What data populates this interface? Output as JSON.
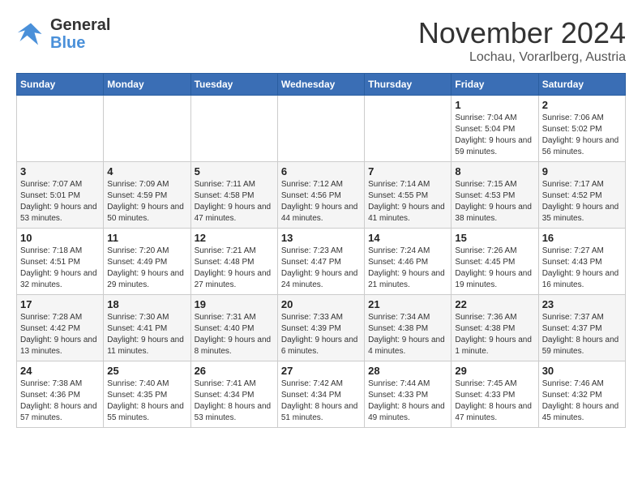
{
  "header": {
    "logo_line1": "General",
    "logo_line2": "Blue",
    "month": "November 2024",
    "location": "Lochau, Vorarlberg, Austria"
  },
  "weekdays": [
    "Sunday",
    "Monday",
    "Tuesday",
    "Wednesday",
    "Thursday",
    "Friday",
    "Saturday"
  ],
  "weeks": [
    [
      {
        "day": "",
        "info": ""
      },
      {
        "day": "",
        "info": ""
      },
      {
        "day": "",
        "info": ""
      },
      {
        "day": "",
        "info": ""
      },
      {
        "day": "",
        "info": ""
      },
      {
        "day": "1",
        "info": "Sunrise: 7:04 AM\nSunset: 5:04 PM\nDaylight: 9 hours and 59 minutes."
      },
      {
        "day": "2",
        "info": "Sunrise: 7:06 AM\nSunset: 5:02 PM\nDaylight: 9 hours and 56 minutes."
      }
    ],
    [
      {
        "day": "3",
        "info": "Sunrise: 7:07 AM\nSunset: 5:01 PM\nDaylight: 9 hours and 53 minutes."
      },
      {
        "day": "4",
        "info": "Sunrise: 7:09 AM\nSunset: 4:59 PM\nDaylight: 9 hours and 50 minutes."
      },
      {
        "day": "5",
        "info": "Sunrise: 7:11 AM\nSunset: 4:58 PM\nDaylight: 9 hours and 47 minutes."
      },
      {
        "day": "6",
        "info": "Sunrise: 7:12 AM\nSunset: 4:56 PM\nDaylight: 9 hours and 44 minutes."
      },
      {
        "day": "7",
        "info": "Sunrise: 7:14 AM\nSunset: 4:55 PM\nDaylight: 9 hours and 41 minutes."
      },
      {
        "day": "8",
        "info": "Sunrise: 7:15 AM\nSunset: 4:53 PM\nDaylight: 9 hours and 38 minutes."
      },
      {
        "day": "9",
        "info": "Sunrise: 7:17 AM\nSunset: 4:52 PM\nDaylight: 9 hours and 35 minutes."
      }
    ],
    [
      {
        "day": "10",
        "info": "Sunrise: 7:18 AM\nSunset: 4:51 PM\nDaylight: 9 hours and 32 minutes."
      },
      {
        "day": "11",
        "info": "Sunrise: 7:20 AM\nSunset: 4:49 PM\nDaylight: 9 hours and 29 minutes."
      },
      {
        "day": "12",
        "info": "Sunrise: 7:21 AM\nSunset: 4:48 PM\nDaylight: 9 hours and 27 minutes."
      },
      {
        "day": "13",
        "info": "Sunrise: 7:23 AM\nSunset: 4:47 PM\nDaylight: 9 hours and 24 minutes."
      },
      {
        "day": "14",
        "info": "Sunrise: 7:24 AM\nSunset: 4:46 PM\nDaylight: 9 hours and 21 minutes."
      },
      {
        "day": "15",
        "info": "Sunrise: 7:26 AM\nSunset: 4:45 PM\nDaylight: 9 hours and 19 minutes."
      },
      {
        "day": "16",
        "info": "Sunrise: 7:27 AM\nSunset: 4:43 PM\nDaylight: 9 hours and 16 minutes."
      }
    ],
    [
      {
        "day": "17",
        "info": "Sunrise: 7:28 AM\nSunset: 4:42 PM\nDaylight: 9 hours and 13 minutes."
      },
      {
        "day": "18",
        "info": "Sunrise: 7:30 AM\nSunset: 4:41 PM\nDaylight: 9 hours and 11 minutes."
      },
      {
        "day": "19",
        "info": "Sunrise: 7:31 AM\nSunset: 4:40 PM\nDaylight: 9 hours and 8 minutes."
      },
      {
        "day": "20",
        "info": "Sunrise: 7:33 AM\nSunset: 4:39 PM\nDaylight: 9 hours and 6 minutes."
      },
      {
        "day": "21",
        "info": "Sunrise: 7:34 AM\nSunset: 4:38 PM\nDaylight: 9 hours and 4 minutes."
      },
      {
        "day": "22",
        "info": "Sunrise: 7:36 AM\nSunset: 4:38 PM\nDaylight: 9 hours and 1 minute."
      },
      {
        "day": "23",
        "info": "Sunrise: 7:37 AM\nSunset: 4:37 PM\nDaylight: 8 hours and 59 minutes."
      }
    ],
    [
      {
        "day": "24",
        "info": "Sunrise: 7:38 AM\nSunset: 4:36 PM\nDaylight: 8 hours and 57 minutes."
      },
      {
        "day": "25",
        "info": "Sunrise: 7:40 AM\nSunset: 4:35 PM\nDaylight: 8 hours and 55 minutes."
      },
      {
        "day": "26",
        "info": "Sunrise: 7:41 AM\nSunset: 4:34 PM\nDaylight: 8 hours and 53 minutes."
      },
      {
        "day": "27",
        "info": "Sunrise: 7:42 AM\nSunset: 4:34 PM\nDaylight: 8 hours and 51 minutes."
      },
      {
        "day": "28",
        "info": "Sunrise: 7:44 AM\nSunset: 4:33 PM\nDaylight: 8 hours and 49 minutes."
      },
      {
        "day": "29",
        "info": "Sunrise: 7:45 AM\nSunset: 4:33 PM\nDaylight: 8 hours and 47 minutes."
      },
      {
        "day": "30",
        "info": "Sunrise: 7:46 AM\nSunset: 4:32 PM\nDaylight: 8 hours and 45 minutes."
      }
    ]
  ]
}
